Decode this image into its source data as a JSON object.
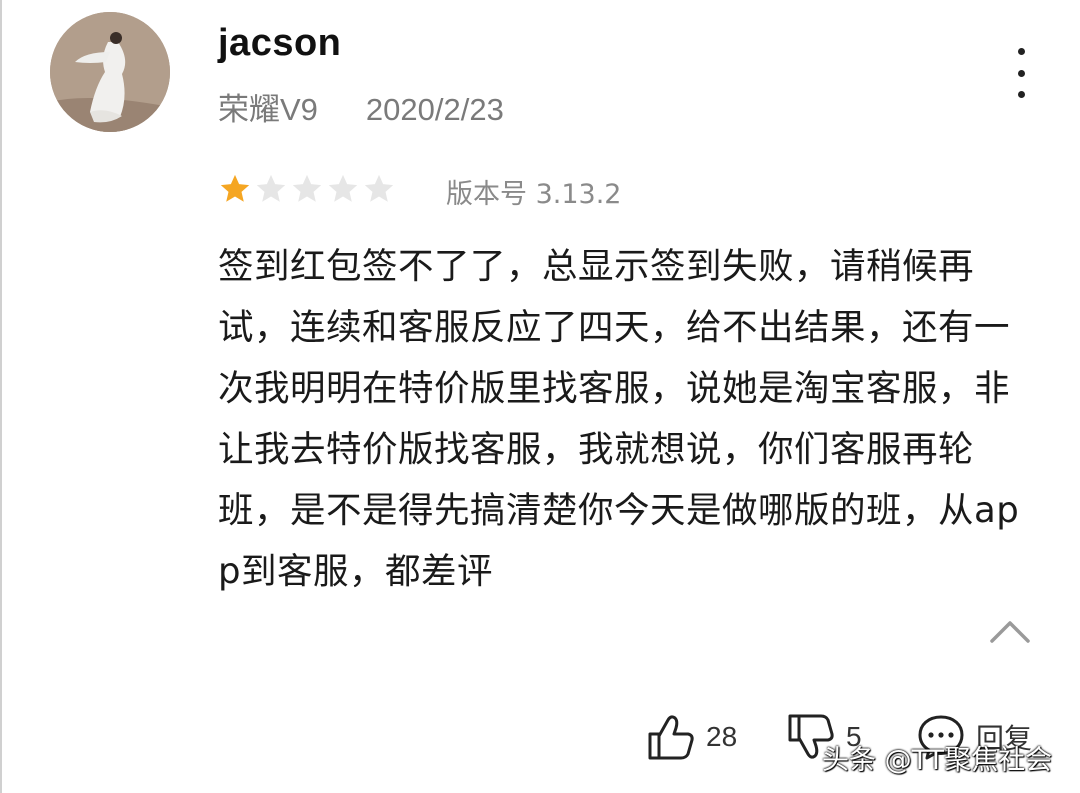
{
  "user": {
    "name": "jacson",
    "device": "荣耀V9",
    "date": "2020/2/23"
  },
  "rating": {
    "value": 1,
    "max": 5,
    "filled_color": "#f5a623",
    "empty_color": "#e6e6e6"
  },
  "version_label": "版本号 3.13.2",
  "review_text": "签到红包签不了了，总显示签到失败，请稍候再试，连续和客服反应了四天，给不出结果，还有一次我明明在特价版里找客服，说她是淘宝客服，非让我去特价版找客服，我就想说，你们客服再轮班，是不是得先搞清楚你今天是做哪版的班，从app到客服，都差评",
  "actions": {
    "like_count": "28",
    "dislike_count": "5",
    "reply_label": "回复"
  },
  "watermark": "头条 @TT聚焦社会",
  "icons": {
    "more": "more-vertical-icon",
    "collapse": "chevron-up-icon",
    "like": "thumbs-up-icon",
    "dislike": "thumbs-down-icon",
    "reply": "comment-icon"
  }
}
